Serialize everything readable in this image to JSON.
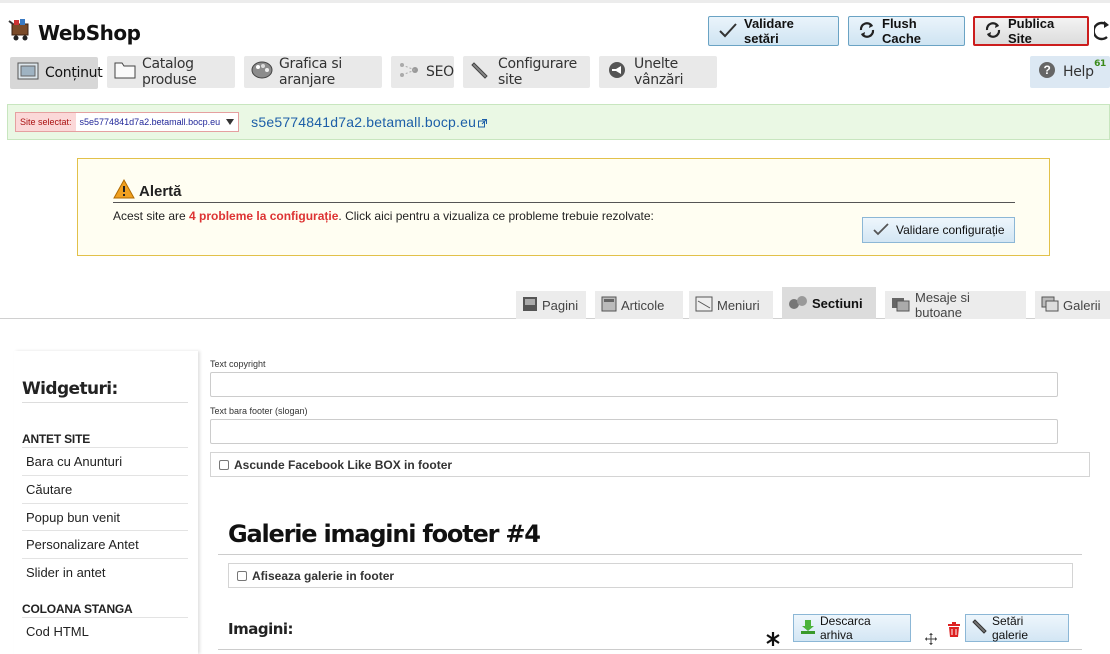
{
  "header": {
    "logo_text": "WebShop",
    "validate_label": "Validare setări",
    "flush_label": "Flush Cache",
    "publish_label": "Publica Site"
  },
  "nav": {
    "items": [
      {
        "label": "Conținut",
        "icon": "content-icon"
      },
      {
        "label": "Catalog produse",
        "icon": "catalog-icon"
      },
      {
        "label": "Grafica si aranjare",
        "icon": "palette-icon"
      },
      {
        "label": "SEO",
        "icon": "seo-icon"
      },
      {
        "label": "Configurare site",
        "icon": "wrench-icon"
      },
      {
        "label": "Unelte vânzări",
        "icon": "megaphone-icon"
      }
    ],
    "help_label": "Help",
    "help_badge": "61"
  },
  "site": {
    "selector_label": "Site selectat:",
    "selector_value": "s5e5774841d7a2.betamall.bocp.eu",
    "link_text": "s5e5774841d7a2.betamall.bocp.eu"
  },
  "alert": {
    "title": "Alertă",
    "text_before": "Acest site are ",
    "text_highlight": "4 probleme la configurație",
    "text_after": ". Click aici pentru a vizualiza ce probleme trebuie rezolvate:",
    "button_label": "Validare configurație",
    "highlight_color": "#dd3333"
  },
  "subtabs": [
    {
      "label": "Pagini"
    },
    {
      "label": "Articole"
    },
    {
      "label": "Meniuri"
    },
    {
      "label": "Sectiuni"
    },
    {
      "label": "Mesaje si butoane"
    },
    {
      "label": "Galerii"
    }
  ],
  "sidebar": {
    "title": "Widgeturi:",
    "group1": "ANTET SITE",
    "group1_items": [
      "Bara cu Anunturi",
      "Căutare",
      "Popup bun venit",
      "Personalizare Antet",
      "Slider in antet"
    ],
    "group2": "COLOANA STANGA",
    "group2_items": [
      "Cod HTML"
    ]
  },
  "form": {
    "copyright_label": "Text copyright",
    "copyright_value": "",
    "slogan_label": "Text bara footer (slogan)",
    "slogan_value": "",
    "hide_fb_label": "Ascunde Facebook Like BOX in footer",
    "gallery_title": "Galerie imagini footer #4",
    "show_gallery_label": "Afiseaza galerie in footer",
    "images_title": "Imagini:",
    "download_label": "Descarca arhiva",
    "settings_label": "Setări galerie"
  },
  "colors": {
    "accent": "#1d5fa8",
    "publish_border": "#cc1d1d",
    "site_bar": "#eaf8e4",
    "alert_border": "#e2c14a"
  }
}
